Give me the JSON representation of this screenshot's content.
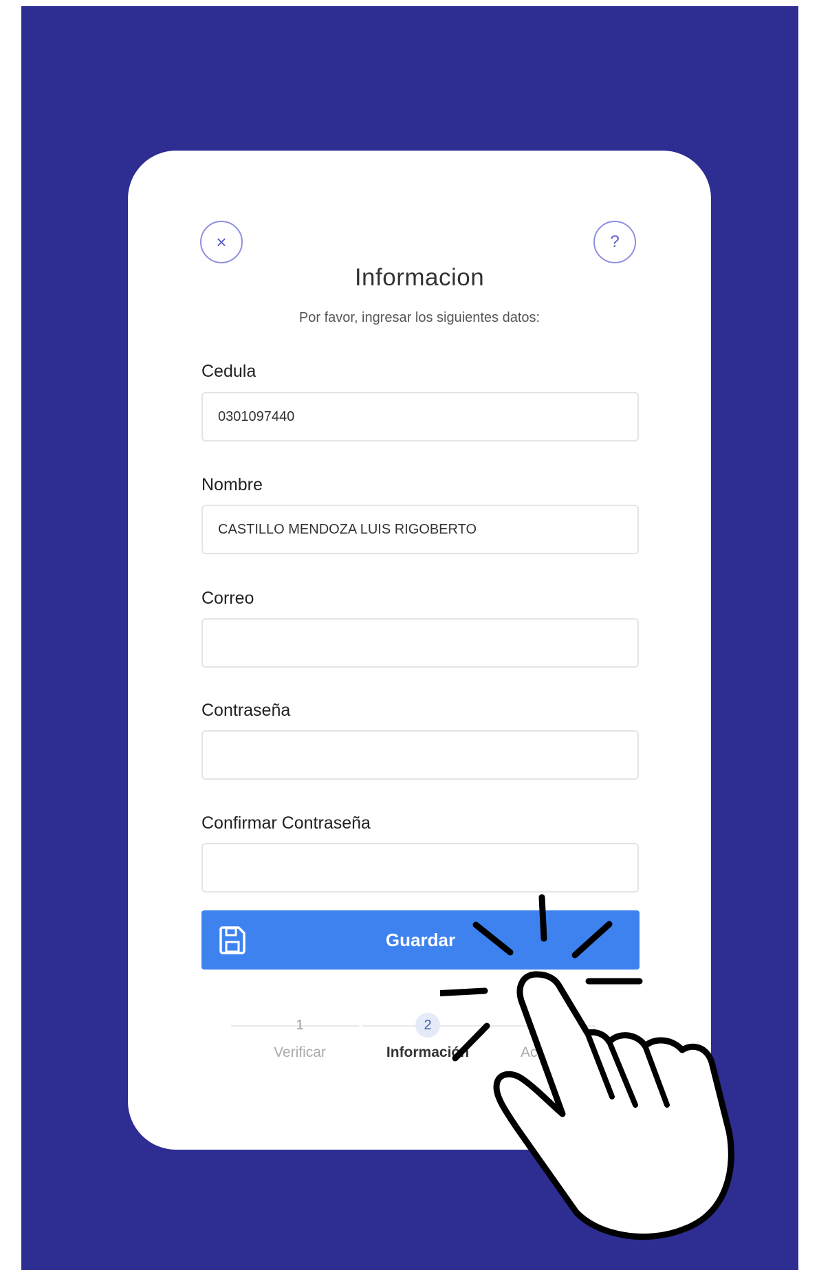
{
  "form": {
    "title": "Informacion",
    "subtitle": "Por favor, ingresar los siguientes datos:",
    "close_icon": "close-icon",
    "help_icon": "help-icon",
    "help_glyph": "?",
    "close_glyph": "×",
    "fields": [
      {
        "label": "Cedula",
        "value": "0301097440",
        "placeholder": ""
      },
      {
        "label": "Nombre",
        "value": "CASTILLO MENDOZA LUIS RIGOBERTO",
        "placeholder": ""
      },
      {
        "label": "Correo",
        "value": "",
        "placeholder": ""
      },
      {
        "label": "Contraseña",
        "value": "",
        "placeholder": ""
      },
      {
        "label": "Confirmar Contraseña",
        "value": "",
        "placeholder": ""
      }
    ],
    "save_button": {
      "label": "Guardar",
      "icon": "floppy-disk-icon"
    }
  },
  "stepper": {
    "steps": [
      {
        "number": "1",
        "label": "Verificar",
        "active": false
      },
      {
        "number": "2",
        "label": "Información",
        "active": true
      },
      {
        "number": "",
        "label": "Acti",
        "active": false
      }
    ]
  },
  "colors": {
    "backdrop": "#2e2d92",
    "card": "#ffffff",
    "primary_button": "#3e82f0",
    "circle_button_border": "#8e8ee0"
  },
  "overlay": {
    "icon": "tap-hand-icon"
  }
}
